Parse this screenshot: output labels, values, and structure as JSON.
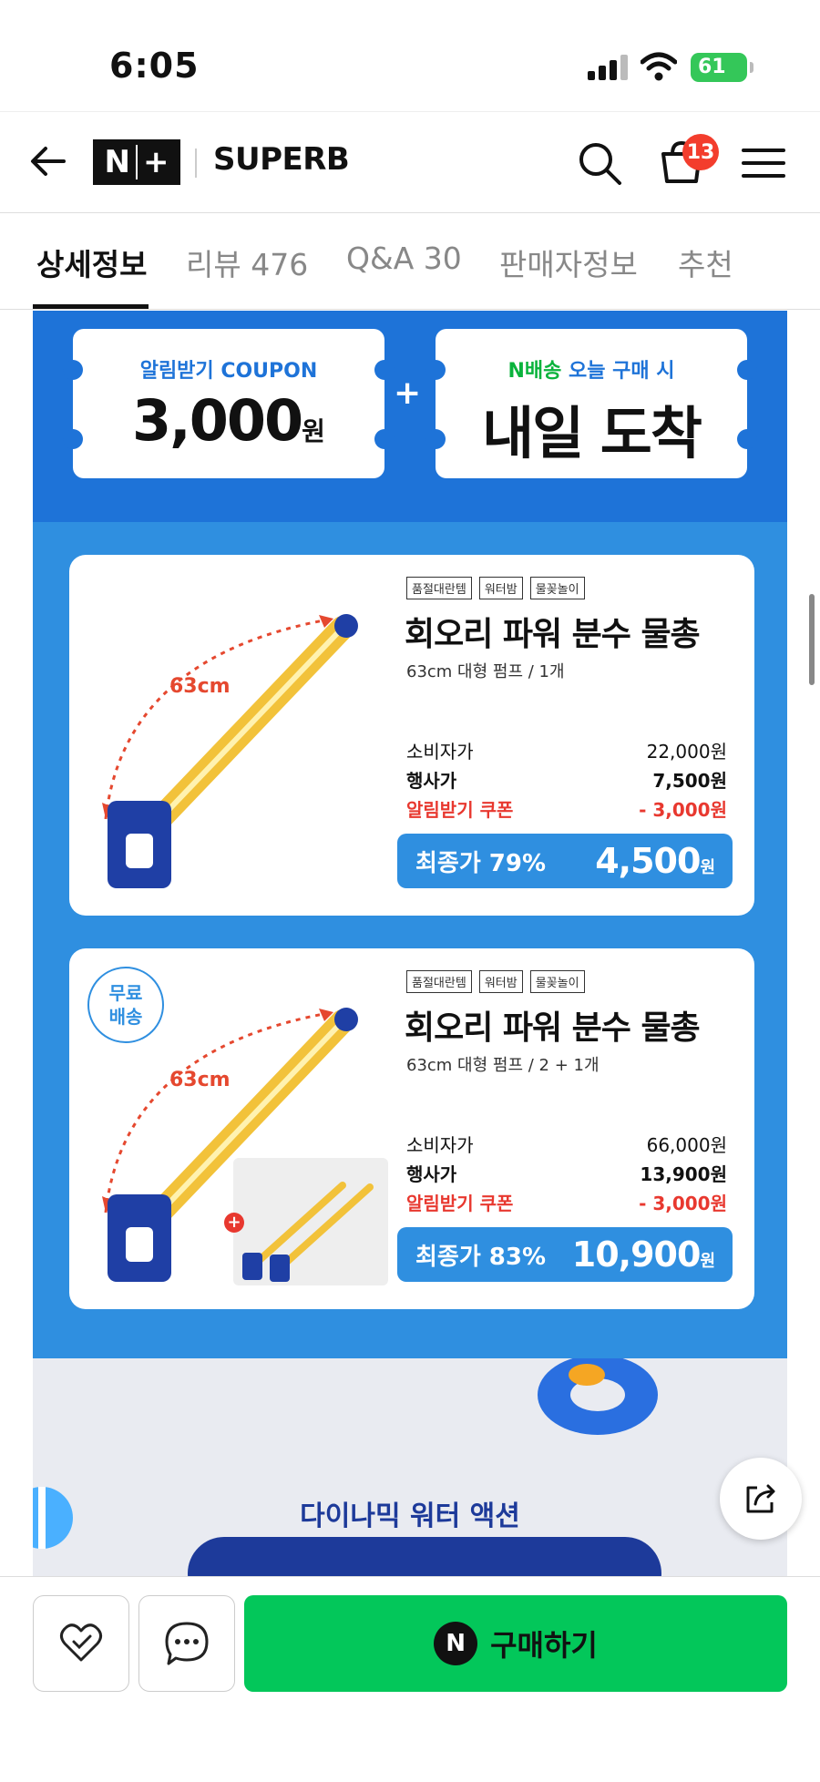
{
  "status": {
    "time": "6:05",
    "battery": "61"
  },
  "header": {
    "brand": "SUPERB",
    "logo": "N+",
    "cart_count": "13"
  },
  "tabs": [
    {
      "label": "상세정보"
    },
    {
      "label": "리뷰 476"
    },
    {
      "label": "Q&A 30"
    },
    {
      "label": "판매자정보"
    },
    {
      "label": "추천"
    }
  ],
  "promo": {
    "coupon_small": "알림받기 COUPON",
    "coupon_value": "3,000",
    "coupon_unit": "원",
    "plus": "+",
    "delivery_small_green": "N배송",
    "delivery_small_rest": " 오늘 구매 시",
    "delivery_big": "내일 도착"
  },
  "products": [
    {
      "tags": [
        "품절대란템",
        "워터밤",
        "물꽂놀이"
      ],
      "title": "회오리 파워 분수 물총",
      "subtitle": "63cm 대형 펌프 / 1개",
      "size_label": "63cm",
      "retail_label": "소비자가",
      "retail_price": "22,000원",
      "event_label": "행사가",
      "event_price": "7,500원",
      "coupon_label": "알림받기 쿠폰",
      "coupon_price": "- 3,000원",
      "final_label": "최종가 79%",
      "final_price": "4,500",
      "final_unit": "원"
    },
    {
      "badge": "무료\n배송",
      "tags": [
        "품절대란템",
        "워터밤",
        "물꽂놀이"
      ],
      "title": "회오리 파워 분수 물총",
      "subtitle": "63cm 대형 펌프 / 2 + 1개",
      "size_label": "63cm",
      "retail_label": "소비자가",
      "retail_price": "66,000원",
      "event_label": "행사가",
      "event_price": "13,900원",
      "coupon_label": "알림받기 쿠폰",
      "coupon_price": "- 3,000원",
      "final_label": "최종가 83%",
      "final_price": "10,900",
      "final_unit": "원"
    }
  ],
  "lower_banner": {
    "text": "다이나믹 워터 액션"
  },
  "bottom": {
    "buy_label": "구매하기",
    "buy_n": "N"
  },
  "colors": {
    "naver_green": "#03c75a",
    "banner_blue": "#2f8fe0",
    "banner_dark_blue": "#1e73d8",
    "price_red": "#e8382f"
  }
}
